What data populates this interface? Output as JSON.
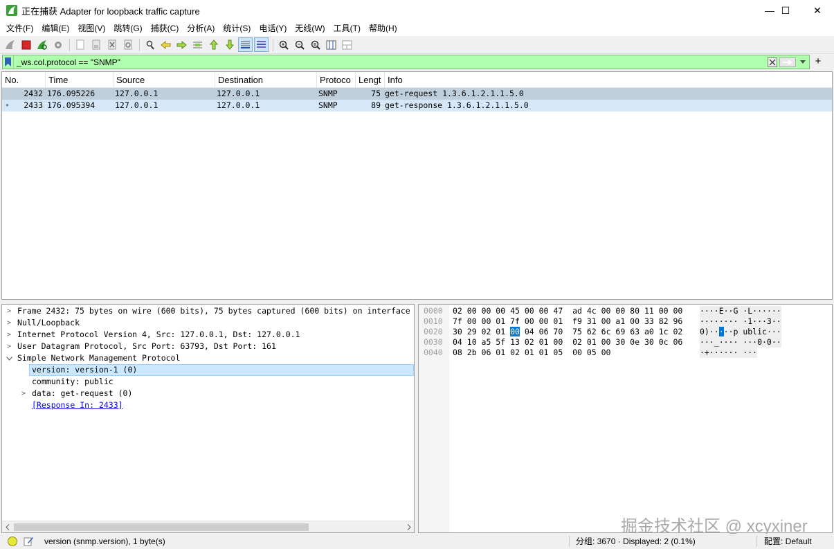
{
  "window": {
    "title": "正在捕获 Adapter for loopback traffic capture",
    "minimize": "—",
    "maximize": "☐",
    "close": "✕"
  },
  "menu": [
    "文件(F)",
    "编辑(E)",
    "视图(V)",
    "跳转(G)",
    "捕获(C)",
    "分析(A)",
    "统计(S)",
    "电话(Y)",
    "无线(W)",
    "工具(T)",
    "帮助(H)"
  ],
  "filter": {
    "value": "_ws.col.protocol == \"SNMP\"",
    "add_label": "+"
  },
  "packet_list": {
    "columns": [
      "No.",
      "Time",
      "Source",
      "Destination",
      "Protoco",
      "Lengt",
      "Info"
    ],
    "rows": [
      {
        "marker": "",
        "no": "2432",
        "time": "176.095226",
        "source": "127.0.0.1",
        "destination": "127.0.0.1",
        "protocol": "SNMP",
        "length": "75",
        "info": "get-request 1.3.6.1.2.1.1.5.0"
      },
      {
        "marker": "•",
        "no": "2433",
        "time": "176.095394",
        "source": "127.0.0.1",
        "destination": "127.0.0.1",
        "protocol": "SNMP",
        "length": "89",
        "info": "get-response 1.3.6.1.2.1.1.5.0"
      }
    ]
  },
  "details": [
    {
      "text": "Frame 2432: 75 bytes on wire (600 bits), 75 bytes captured (600 bits) on interface",
      "arrow": ">"
    },
    {
      "text": "Null/Loopback",
      "arrow": ">"
    },
    {
      "text": "Internet Protocol Version 4, Src: 127.0.0.1, Dst: 127.0.0.1",
      "arrow": ">"
    },
    {
      "text": "User Datagram Protocol, Src Port: 63793, Dst Port: 161",
      "arrow": ">"
    },
    {
      "text": "Simple Network Management Protocol",
      "arrow": "v"
    },
    {
      "text": "version: version-1 (0)",
      "arrow": ""
    },
    {
      "text": "community: public",
      "arrow": ""
    },
    {
      "text": "data: get-request (0)",
      "arrow": ">"
    },
    {
      "text": "[Response In: 2433]",
      "arrow": ""
    }
  ],
  "bytes": {
    "offsets": [
      "0000",
      "0010",
      "0020",
      "0030",
      "0040"
    ],
    "hex": [
      "02 00 00 00 45 00 00 47  ad 4c 00 00 80 11 00 00",
      "7f 00 00 01 7f 00 00 01  f9 31 00 a1 00 33 82 96",
      "30 29 02 01 |00| 04 06 70  75 62 6c 69 63 a0 1c 02",
      "04 10 a5 5f 13 02 01 00  02 01 00 30 0e 30 0c 06",
      "08 2b 06 01 02 01 01 05  00 05 00"
    ],
    "hex_pre": "30 29 02 01 ",
    "hex_sel": "00",
    "hex_post": " 04 06 70  75 62 6c 69 63 a0 1c 02",
    "ascii": [
      "····E··G ·L······",
      "········ ·1···3··",
      "",
      "···_···· ···0·0··",
      "·+······ ···"
    ],
    "ascii_pre": "0)··",
    "ascii_sel": "·",
    "ascii_post": "··p ublic···"
  },
  "watermark": "掘金技术社区 @ xcyxiner",
  "status": {
    "field": "version (snmp.version), 1 byte(s)",
    "packets": "分组: 3670 · Displayed: 2 (0.1%)",
    "profile": "配置: Default"
  }
}
